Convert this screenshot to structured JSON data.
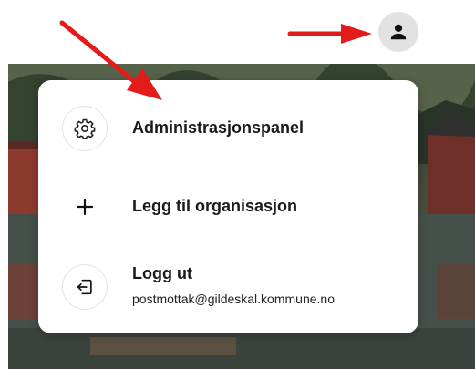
{
  "header": {
    "account_icon": "person-icon"
  },
  "menu": {
    "items": [
      {
        "label": "Administrasjonspanel",
        "icon": "gear-icon"
      },
      {
        "label": "Legg til organisasjon",
        "icon": "plus-icon"
      },
      {
        "label": "Logg ut",
        "sublabel": "postmottak@gildeskal.kommune.no",
        "icon": "logout-icon"
      }
    ]
  },
  "annotations": {
    "arrow_color": "#e31b1b"
  },
  "colors": {
    "avatar_bg": "#e2e2e2",
    "menu_bg": "#ffffff",
    "text": "#1a1a1a"
  }
}
